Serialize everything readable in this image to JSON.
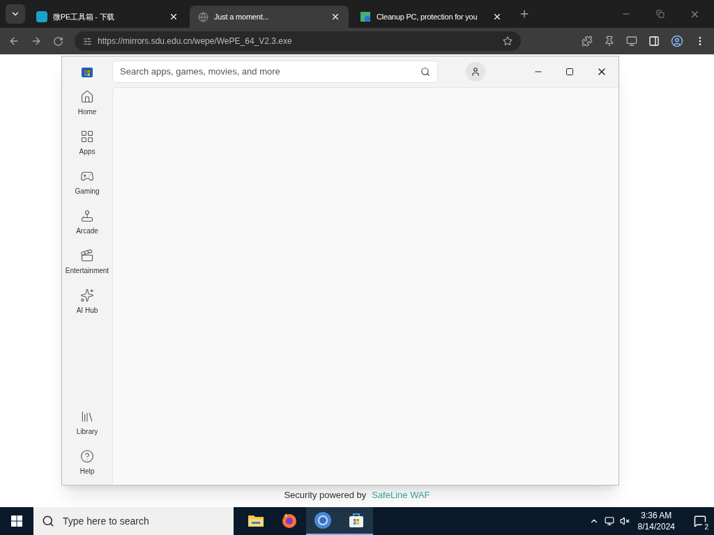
{
  "browser": {
    "tabs": [
      {
        "title": "微PE工具箱 - 下载",
        "selected": false
      },
      {
        "title": "Just a moment...",
        "selected": true
      },
      {
        "title": "Cleanup PC, protection for you",
        "selected": false
      }
    ],
    "address": "https://mirrors.sdu.edu.cn/wepe/WePE_64_V2.3.exe",
    "page_footer": {
      "text": "Security powered by",
      "link": "SafeLine WAF"
    }
  },
  "store": {
    "search": {
      "placeholder": "Search apps, games, movies, and more"
    },
    "nav": [
      {
        "label": "Home",
        "kind": "home"
      },
      {
        "label": "Apps",
        "kind": "apps"
      },
      {
        "label": "Gaming",
        "kind": "gaming"
      },
      {
        "label": "Arcade",
        "kind": "arcade"
      },
      {
        "label": "Entertainment",
        "kind": "entertainment"
      },
      {
        "label": "AI Hub",
        "kind": "ai"
      }
    ],
    "nav_bottom": [
      {
        "label": "Library",
        "kind": "library"
      },
      {
        "label": "Help",
        "kind": "help"
      }
    ]
  },
  "taskbar": {
    "search": {
      "placeholder": "Type here to search"
    },
    "apps": [
      {
        "kind": "files",
        "active": false
      },
      {
        "kind": "firefox",
        "active": false
      },
      {
        "kind": "chrome",
        "active": true
      },
      {
        "kind": "store",
        "active": true
      }
    ],
    "time": "3:36 AM",
    "date": "8/14/2024",
    "notifications": "2"
  }
}
